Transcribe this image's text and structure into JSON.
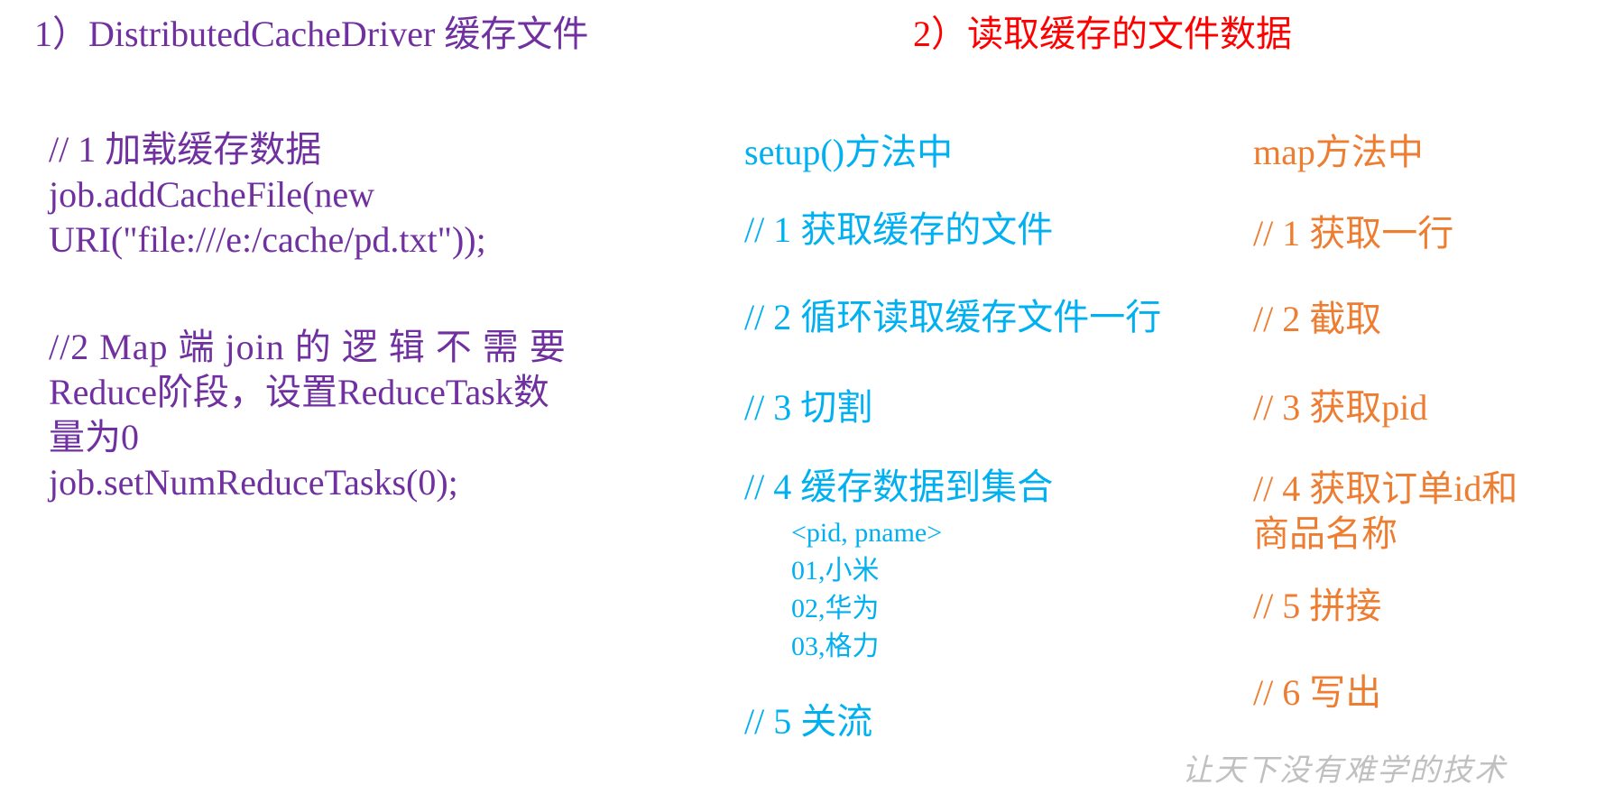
{
  "heading_left": "1）DistributedCacheDriver 缓存文件",
  "heading_right": "2）读取缓存的文件数据",
  "left_block": {
    "line1": "// 1 加载缓存数据",
    "line2": "job.addCacheFile(new",
    "line3": "URI(\"file:///e:/cache/pd.txt\"));",
    "line4": "//2  Map 端 join 的 逻 辑 不 需 要",
    "line5": "Reduce阶段，设置ReduceTask数",
    "line6": "量为0",
    "line7": "job.setNumReduceTasks(0);"
  },
  "setup_column": {
    "title": "setup()方法中",
    "step1": "// 1 获取缓存的文件",
    "step2": "// 2 循环读取缓存文件一行",
    "step3": "// 3 切割",
    "step4": "// 4 缓存数据到集合",
    "sample_header": "<pid, pname>",
    "sample_rows": [
      "01,小米",
      "02,华为",
      "03,格力"
    ],
    "step5": "// 5 关流"
  },
  "map_column": {
    "title": "map方法中",
    "step1": "// 1 获取一行",
    "step2": "// 2 截取",
    "step3": "// 3 获取pid",
    "step4_line1": "// 4 获取订单id和",
    "step4_line2": "商品名称",
    "step5": "// 5 拼接",
    "step6": "// 6 写出"
  },
  "watermark": "让天下没有难学的技术",
  "colors": {
    "purple": "#7030a0",
    "red": "#ff0000",
    "blue": "#00b0f0",
    "orange": "#ed7d31"
  }
}
